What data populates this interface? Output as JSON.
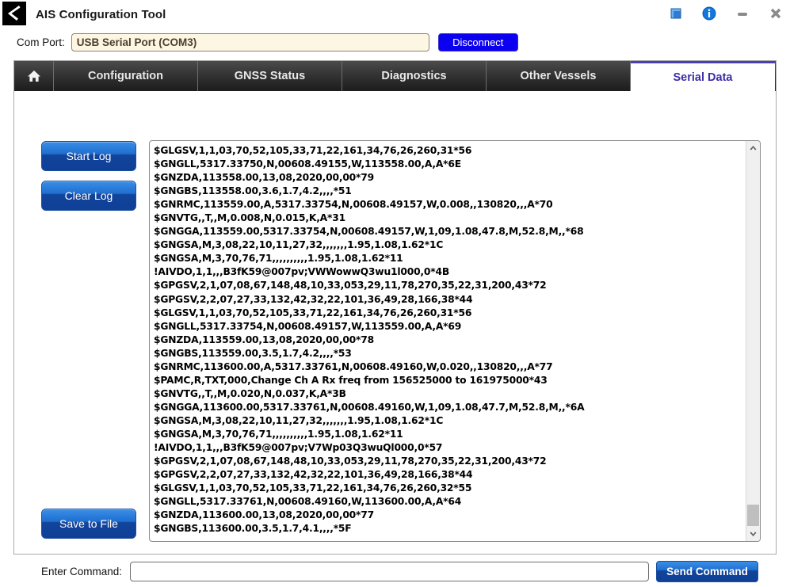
{
  "window": {
    "title": "AIS Configuration Tool",
    "app_icon": "chevron-logo-icon",
    "controls": [
      {
        "name": "book-icon",
        "glyph": "◰"
      },
      {
        "name": "info-icon",
        "glyph": "i"
      },
      {
        "name": "minimize-icon",
        "glyph": "—"
      },
      {
        "name": "close-icon",
        "glyph": "✕"
      }
    ]
  },
  "comport": {
    "label": "Com Port:",
    "value": "USB Serial Port (COM3)",
    "placeholder": "",
    "disconnect_label": "Disconnect"
  },
  "tabs": {
    "home_icon": "home-icon",
    "items": [
      {
        "label": "Configuration",
        "active": false
      },
      {
        "label": "GNSS Status",
        "active": false
      },
      {
        "label": "Diagnostics",
        "active": false
      },
      {
        "label": "Other Vessels",
        "active": false
      },
      {
        "label": "Serial Data",
        "active": true
      }
    ]
  },
  "serial": {
    "start_log_label": "Start Log",
    "clear_log_label": "Clear Log",
    "save_file_label": "Save to File",
    "command_label": "Enter Command:",
    "command_value": "",
    "command_placeholder": "",
    "send_label": "Send Command",
    "log": "$GLGSV,1,1,03,70,52,105,33,71,22,161,34,76,26,260,31*56\n$GNGLL,5317.33750,N,00608.49155,W,113558.00,A,A*6E\n$GNZDA,113558.00,13,08,2020,00,00*79\n$GNGBS,113558.00,3.6,1.7,4.2,,,,*51\n$GNRMC,113559.00,A,5317.33754,N,00608.49157,W,0.008,,130820,,,A*70\n$GNVTG,,T,,M,0.008,N,0.015,K,A*31\n$GNGGA,113559.00,5317.33754,N,00608.49157,W,1,09,1.08,47.8,M,52.8,M,,*68\n$GNGSA,M,3,08,22,10,11,27,32,,,,,,,1.95,1.08,1.62*1C\n$GNGSA,M,3,70,76,71,,,,,,,,,,1.95,1.08,1.62*11\n!AIVDO,1,1,,,B3fK59@007pv;VWWowwQ3wu1l000,0*4B\n$GPGSV,2,1,07,08,67,148,48,10,33,053,29,11,78,270,35,22,31,200,43*72\n$GPGSV,2,2,07,27,33,132,42,32,22,101,36,49,28,166,38*44\n$GLGSV,1,1,03,70,52,105,33,71,22,161,34,76,26,260,31*56\n$GNGLL,5317.33754,N,00608.49157,W,113559.00,A,A*69\n$GNZDA,113559.00,13,08,2020,00,00*78\n$GNGBS,113559.00,3.5,1.7,4.2,,,,*53\n$GNRMC,113600.00,A,5317.33761,N,00608.49160,W,0.020,,130820,,,A*77\n$PAMC,R,TXT,000,Change Ch A Rx freq from 156525000 to 161975000*43\n$GNVTG,,T,,M,0.020,N,0.037,K,A*3B\n$GNGGA,113600.00,5317.33761,N,00608.49160,W,1,09,1.08,47.7,M,52.8,M,,*6A\n$GNGSA,M,3,08,22,10,11,27,32,,,,,,,1.95,1.08,1.62*1C\n$GNGSA,M,3,70,76,71,,,,,,,,,,1.95,1.08,1.62*11\n!AIVDO,1,1,,,B3fK59@007pv;V7Wp03Q3wuQl000,0*57\n$GPGSV,2,1,07,08,67,148,48,10,33,053,29,11,78,270,35,22,31,200,43*72\n$GPGSV,2,2,07,27,33,132,42,32,22,101,36,49,28,166,38*44\n$GLGSV,1,1,03,70,52,105,33,71,22,161,34,76,26,260,32*55\n$GNGLL,5317.33761,N,00608.49160,W,113600.00,A,A*64\n$GNZDA,113600.00,13,08,2020,00,00*77\n$GNGBS,113600.00,3.5,1.7,4.1,,,,*5F",
    "scroll_up_icon": "chevron-up-icon",
    "scroll_down_icon": "chevron-down-icon"
  },
  "colors": {
    "accent_blue": "#0c00f0",
    "button_blue": "#1f6fd0",
    "active_tab_text": "#3a2fa8",
    "comport_bg": "#fdf6e3"
  }
}
